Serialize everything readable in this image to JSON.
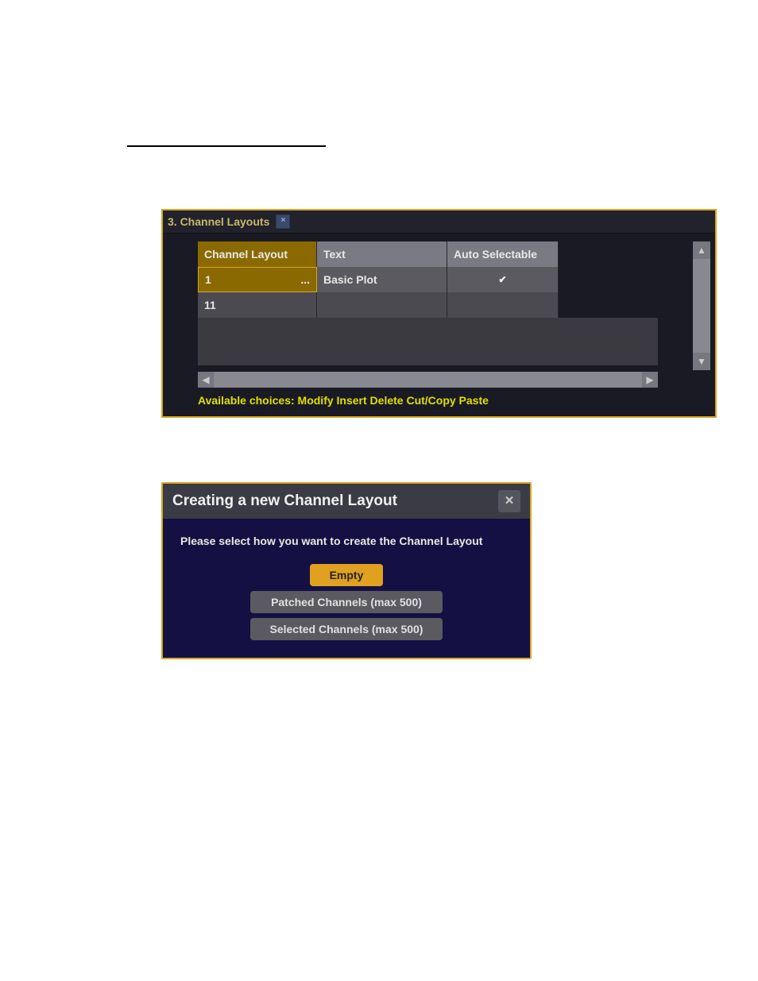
{
  "panel1": {
    "title": "3. Channel Layouts",
    "close_icon": "×",
    "headers": {
      "layout": "Channel Layout",
      "text": "Text",
      "auto": "Auto Selectable"
    },
    "rows": [
      {
        "layout": "1",
        "dots": "...",
        "text": "Basic Plot",
        "auto_checked": true
      },
      {
        "layout": "11",
        "dots": "",
        "text": "",
        "auto_checked": false
      }
    ],
    "footer": "Available choices: Modify Insert Delete Cut/Copy Paste",
    "check_glyph": "✔",
    "arrow_up": "▲",
    "arrow_down": "▼",
    "arrow_left": "◀",
    "arrow_right": "▶"
  },
  "panel2": {
    "title": "Creating a new Channel Layout",
    "close_icon": "✕",
    "prompt": "Please select how you want to create the Channel Layout",
    "buttons": {
      "empty": "Empty",
      "patched": "Patched Channels (max 500)",
      "selected": "Selected Channels (max 500)"
    }
  }
}
